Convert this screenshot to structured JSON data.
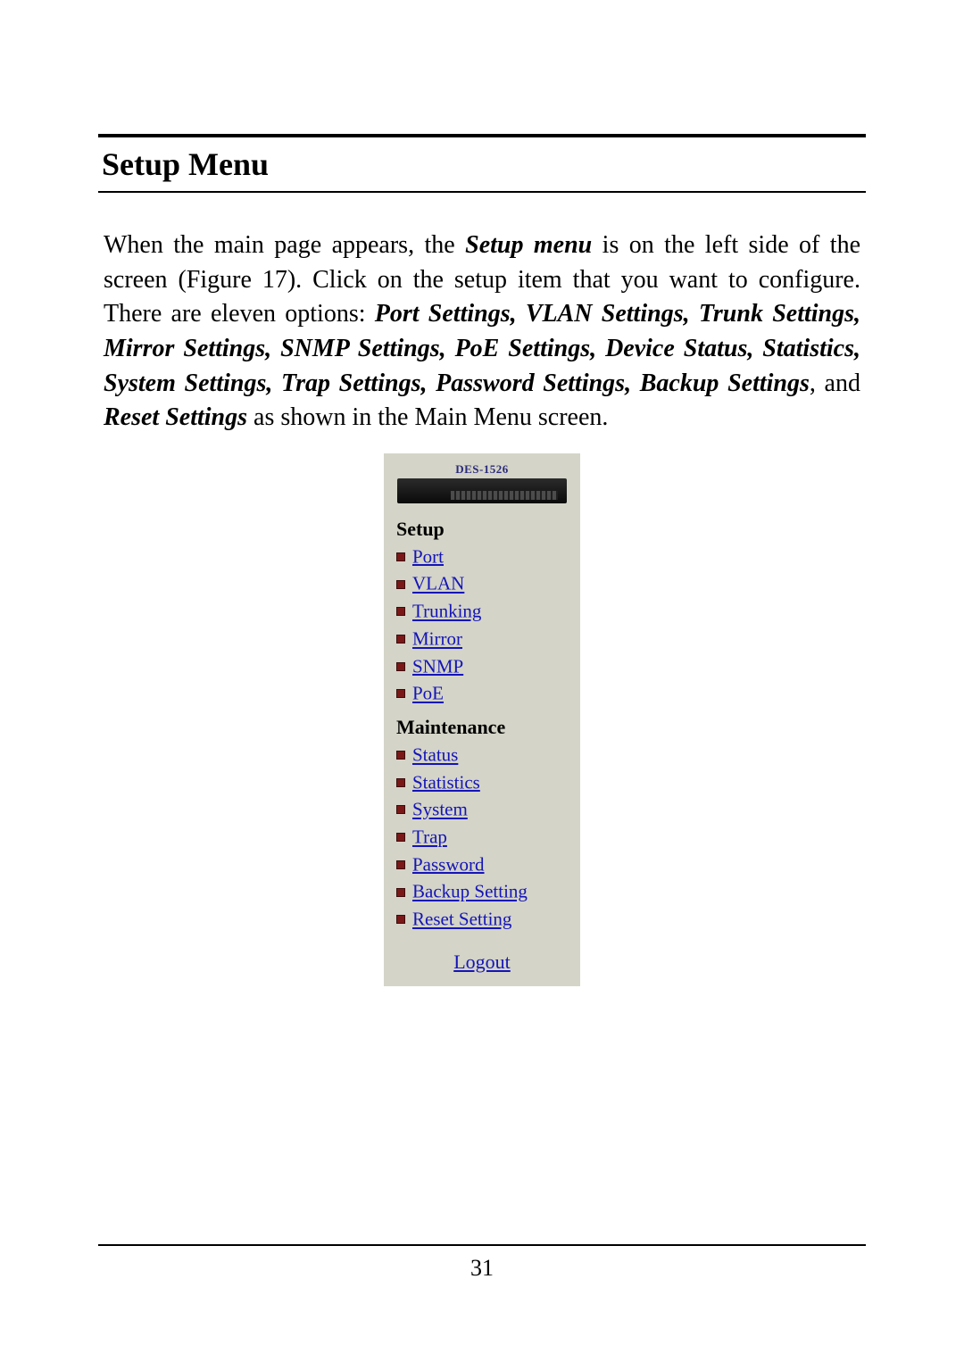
{
  "heading": "Setup Menu",
  "paragraph": {
    "p1": "When the main page appears, the ",
    "p2": "Setup menu",
    "p3": " is on the left side of the screen (Figure 17). Click on the setup item that you want to configure. There are eleven options: ",
    "opts": "Port Settings, VLAN Settings, Trunk Settings, Mirror Settings, SNMP Settings, PoE Settings, Device Status, Statistics, System Settings, Trap Settings, Password Settings, Backup Settings",
    "p4": ", and ",
    "opts2": "Reset Settings",
    "p5": " as shown in the Main Menu screen."
  },
  "panel": {
    "model": "DES-1526",
    "group1": "Setup",
    "setup_items": [
      "Port",
      "VLAN",
      "Trunking",
      "Mirror",
      "SNMP",
      "PoE"
    ],
    "group2": "Maintenance",
    "maint_items": [
      "Status",
      "Statistics",
      "System",
      "Trap",
      "Password",
      "Backup Setting",
      "Reset Setting"
    ],
    "logout": "Logout"
  },
  "page_number": "31"
}
